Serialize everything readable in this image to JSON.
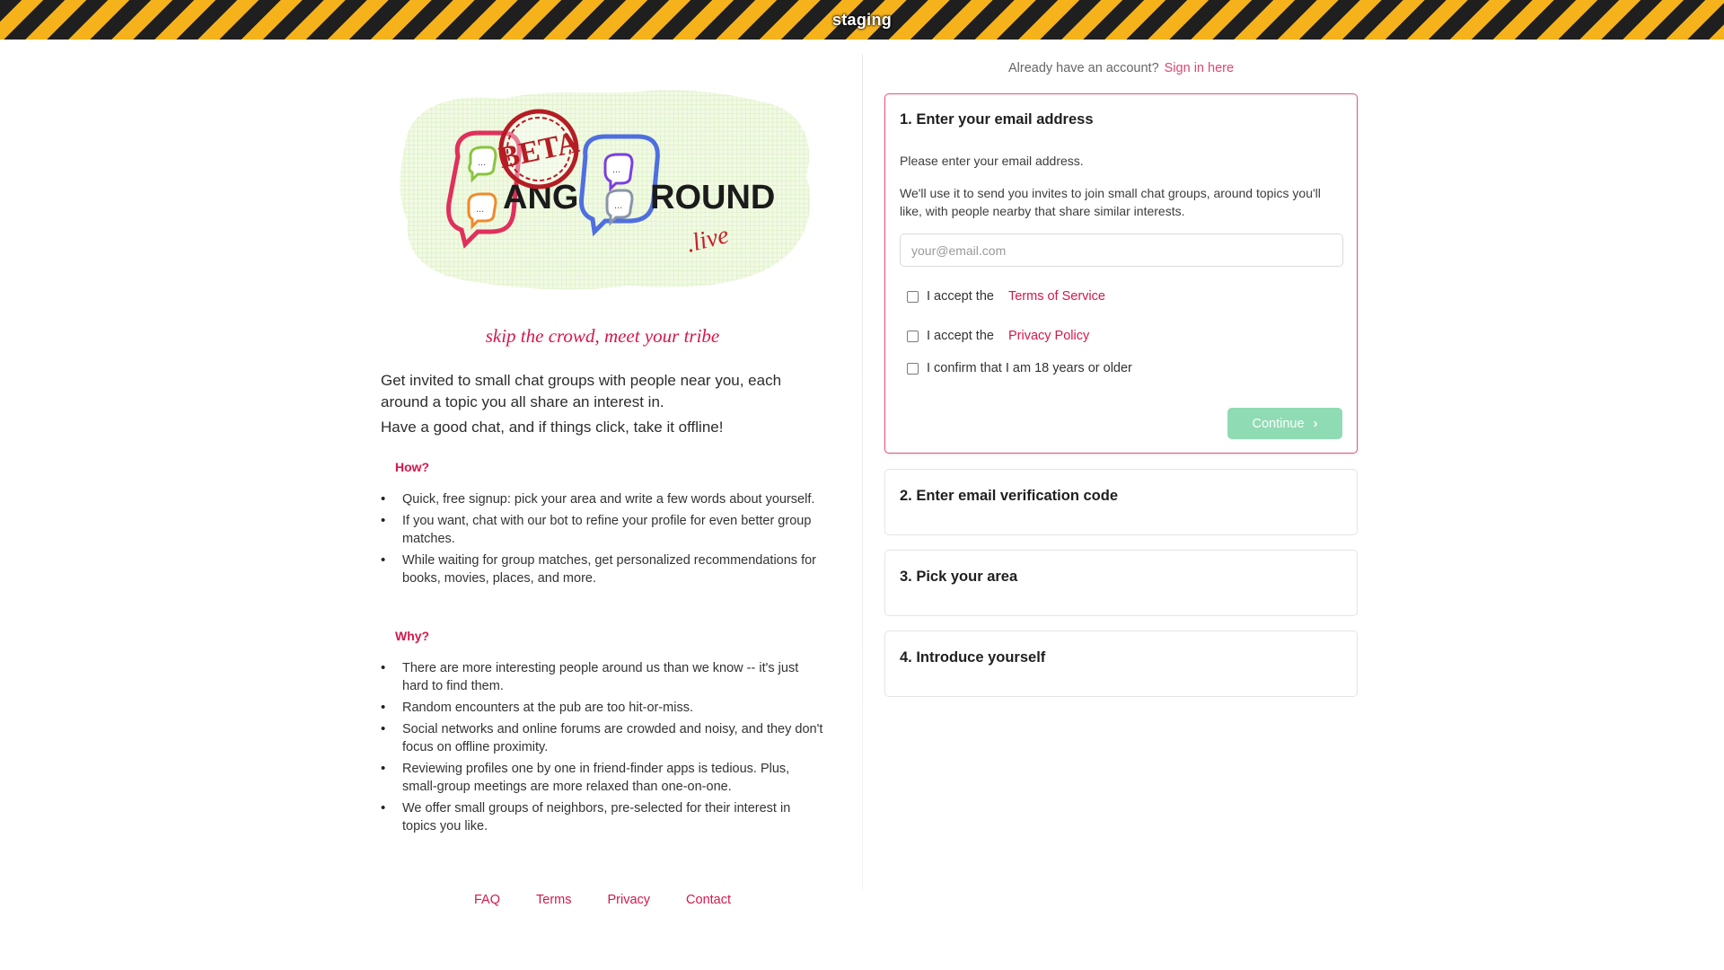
{
  "banner": {
    "label": "staging"
  },
  "logo": {
    "badge": "BETA",
    "word_left": "ANG",
    "word_right": "ROUND",
    "suffix": ".live",
    "bubble_dots": "..."
  },
  "tagline": "skip the crowd, meet your tribe",
  "intro": {
    "line1": "Get invited to small chat groups with people near you, each around a topic you all share an interest in.",
    "line2": "Have a good chat, and if things click, take it offline!"
  },
  "how": {
    "title": "How?",
    "items": [
      "Quick, free signup: pick your area and write a few words about yourself.",
      "If you want, chat with our bot to refine your profile for even better group matches.",
      "While waiting for group matches, get personalized recommendations for books, movies, places, and more."
    ]
  },
  "why": {
    "title": "Why?",
    "items": [
      "There are more interesting people around us than we know -- it's just hard to find them.",
      "Random encounters at the pub are too hit-or-miss.",
      "Social networks and online forums are crowded and noisy, and they don't focus on offline proximity.",
      "Reviewing profiles one by one in friend-finder apps is tedious. Plus, small-group meetings are more relaxed than one-on-one.",
      "We offer small groups of neighbors, pre-selected for their interest in topics you like."
    ]
  },
  "footer": {
    "faq": "FAQ",
    "terms": "Terms",
    "privacy": "Privacy",
    "contact": "Contact"
  },
  "signin": {
    "prompt": "Already have an account?",
    "link": "Sign in here"
  },
  "steps": {
    "step1": {
      "title": "1. Enter your email address",
      "prompt": "Please enter your email address.",
      "explain": "We'll use it to send you invites to join small chat groups, around topics you'll like, with people nearby that share similar interests.",
      "email_value": "",
      "email_placeholder": "your@email.com",
      "tos_prefix": "I accept the",
      "tos_link": "Terms of Service",
      "privacy_prefix": "I accept the",
      "privacy_link": "Privacy Policy",
      "age_label": "I confirm that I am 18 years or older",
      "continue_label": "Continue"
    },
    "step2": {
      "title": "2. Enter email verification code"
    },
    "step3": {
      "title": "3. Pick your area"
    },
    "step4": {
      "title": "4. Introduce yourself"
    }
  },
  "colors": {
    "accent": "#d6174a",
    "continue": "#8fdbb3",
    "stripe_dark": "#1f1f1f",
    "stripe_yellow": "#f5b21a"
  }
}
